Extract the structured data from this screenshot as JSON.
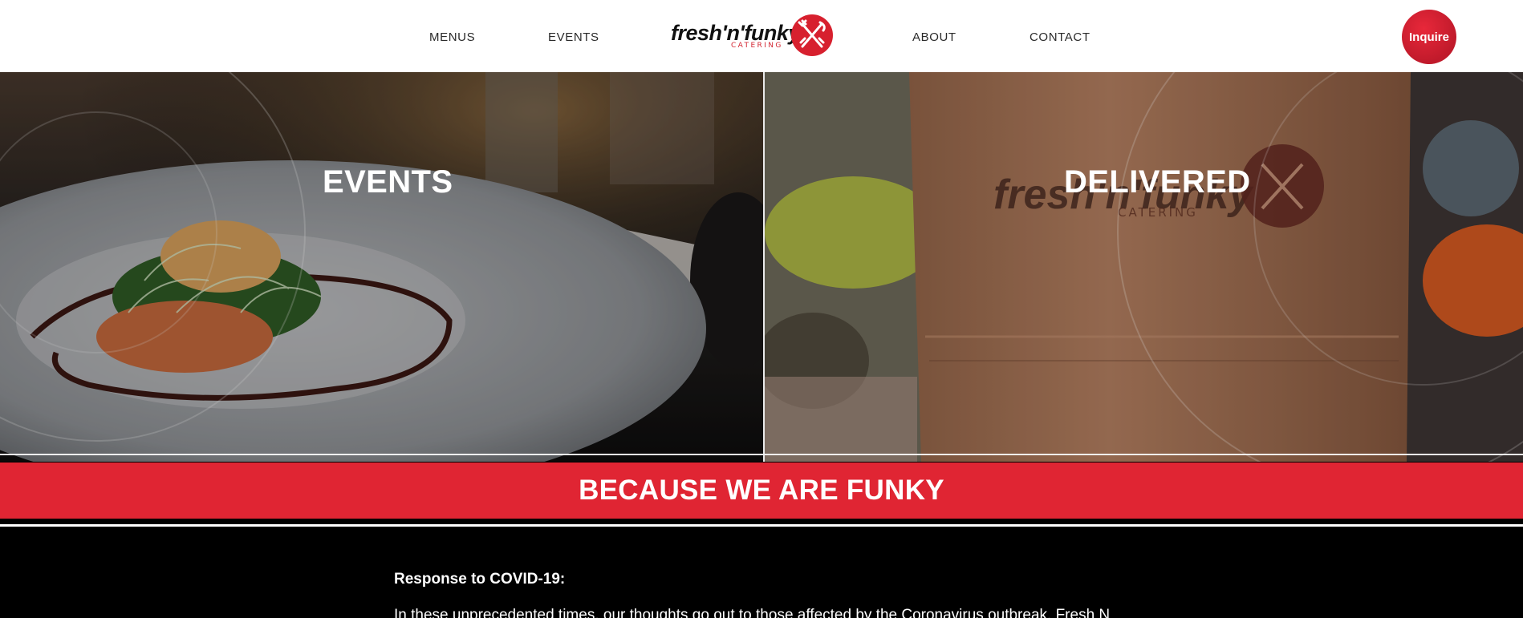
{
  "header": {
    "nav": {
      "menus": "MENUS",
      "events": "EVENTS",
      "about": "ABOUT",
      "contact": "CONTACT"
    },
    "logo": {
      "wordmark": "fresh'n'funky",
      "subtitle": "CATERING",
      "badge_icon": "fork-knife-badge-icon"
    },
    "inquire_label": "Inquire"
  },
  "hero": {
    "left_title": "EVENTS",
    "right_title": "DELIVERED",
    "bag_print": {
      "wordmark": "fresh'n'funky",
      "subtitle": "CATERING"
    }
  },
  "banner": {
    "text": "BECAUSE WE ARE FUNKY"
  },
  "content": {
    "heading": "Response to COVID-19:",
    "paragraph_start": "In these unprecedented times, our thoughts go out to those affected by the Coronavirus outbreak. Fresh N"
  },
  "colors": {
    "brand_red": "#e02533",
    "header_bg": "#ffffff",
    "content_bg": "#000000"
  }
}
